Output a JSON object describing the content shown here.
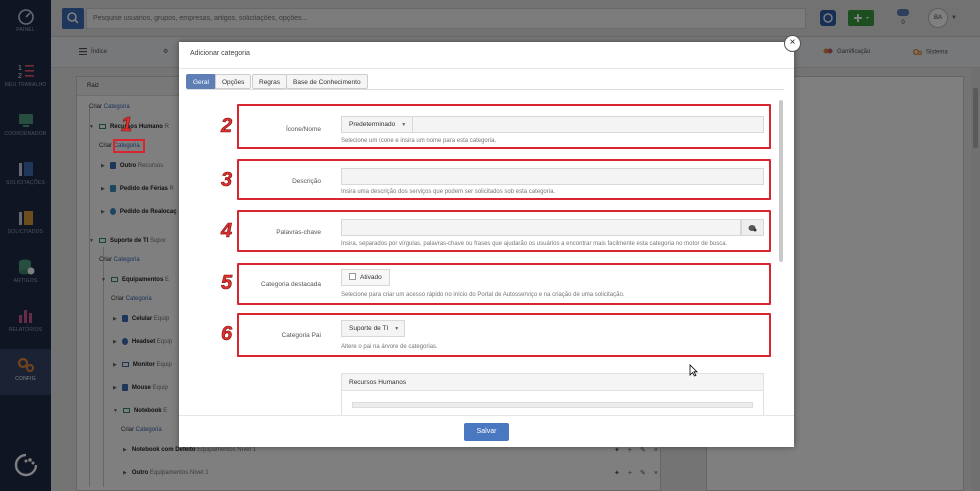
{
  "sidebar": {
    "items": [
      {
        "label": "PAINEL",
        "icon": "dashboard-icon"
      },
      {
        "label": "MEU TRABALHO",
        "icon": "list-icon"
      },
      {
        "label": "COORDENADOR",
        "icon": "monitor-icon"
      },
      {
        "label": "SOLICITAÇÕES",
        "icon": "tickets-icon"
      },
      {
        "label": "SOLICITADOS",
        "icon": "tickets-icon"
      },
      {
        "label": "ARTIGOS",
        "icon": "database-icon"
      },
      {
        "label": "RELATÓRIOS",
        "icon": "chart-icon"
      },
      {
        "label": "CONFIG",
        "icon": "gears-icon"
      }
    ]
  },
  "topbar": {
    "search_placeholder": "Pesquise usuários, grupos, empresas, artigos, solicitações, opções...",
    "ms_count": "0",
    "avatar": "BA"
  },
  "nav": {
    "index": "Índice",
    "gamification": "Gamificação",
    "system": "Sistema"
  },
  "tree": {
    "root": "Raiz",
    "create": "Criar",
    "category": "Categoria",
    "rows": [
      {
        "name": "Recursos Humano",
        "crumb": "R"
      },
      {
        "name": "Outro",
        "crumb": "Recursos"
      },
      {
        "name": "Pedido de Férias",
        "crumb": "R"
      },
      {
        "name": "Pedido de Realocaç",
        "crumb": ""
      },
      {
        "name": "Suporte de TI",
        "crumb": "Supor"
      },
      {
        "name": "Equipamentos",
        "crumb": "E"
      },
      {
        "name": "Celular",
        "crumb": "Equip"
      },
      {
        "name": "Headset",
        "crumb": "Equip"
      },
      {
        "name": "Monitor",
        "crumb": "Equip"
      },
      {
        "name": "Mouse",
        "crumb": "Equip"
      },
      {
        "name": "Notebook",
        "crumb": "E"
      },
      {
        "name": "Notebook com Defeito",
        "crumb": "Equipamentos Nível 1"
      },
      {
        "name": "Outro",
        "crumb": "Equipamentos Nível 1"
      }
    ]
  },
  "modal": {
    "title": "Adicionar categoria",
    "close": "×",
    "tabs": [
      "Geral",
      "Opções",
      "Regras",
      "Base de Conhecimento"
    ],
    "fields": {
      "icon_name": {
        "label": "Ícone/Nome",
        "select": "Predeterminado",
        "help": "Selecione um ícone e insira um nome para esta categoria."
      },
      "description": {
        "label": "Descrição",
        "help": "Insira uma descrição dos serviços que podem ser solicitados sob esta categoria."
      },
      "keywords": {
        "label": "Palavras-chave",
        "help": "Insira, separados por vírgulas, palavras-chave ou frases que ajudarão os usuários a encontrar mais facilmente esta categoria no motor de busca."
      },
      "featured": {
        "label": "Categoria destacada",
        "checkbox": "Ativado",
        "help": "Selecione para criar um acesso rápido no início do Portal de Autosserviço e na criação de uma solicitação."
      },
      "parent": {
        "label": "Categoria Pai",
        "select": "Suporte de TI",
        "help": "Altere o pai na árvore de categorias."
      }
    },
    "parent_tree_head": "Recursos Humanos",
    "save": "Salvar"
  },
  "annotations": [
    "1",
    "2",
    "3",
    "4",
    "5",
    "6"
  ],
  "colors": {
    "sidebar": "#1f2a45",
    "primary": "#4a78c0",
    "annotation": "#d9252f",
    "add": "#3a9d3f"
  }
}
